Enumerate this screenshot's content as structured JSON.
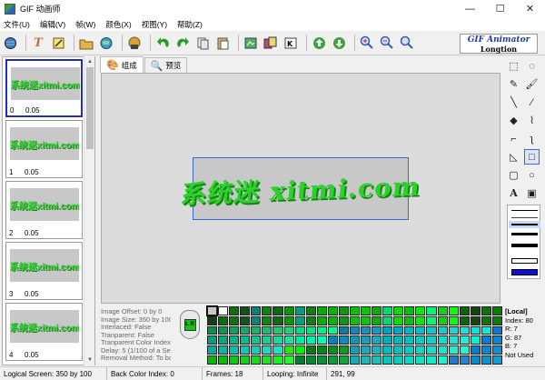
{
  "window": {
    "title": "GIF 动画师",
    "min": "—",
    "max": "☐",
    "close": "✕"
  },
  "menu": [
    "文件(U)",
    "编辑(V)",
    "帧(W)",
    "颜色(X)",
    "视图(Y)",
    "帮助(Z)"
  ],
  "toolbar": {
    "icons": [
      "globe-icon",
      "text-icon",
      "wizard-icon",
      "open-icon",
      "web-icon",
      "save-icon",
      "undo-icon",
      "redo-icon",
      "copy-icon",
      "paste-icon",
      "new-frame-icon",
      "frames-icon",
      "export-icon",
      "up-icon",
      "down-icon",
      "zoom-in-icon",
      "zoom-out-icon",
      "zoom-fit-icon"
    ]
  },
  "brand": {
    "line1": "GIF Animator",
    "line2": "Longtion"
  },
  "frames": [
    {
      "index": "0",
      "delay": "0.05",
      "text": "系统迷xitmi.com"
    },
    {
      "index": "1",
      "delay": "0.05",
      "text": "系统迷xitmi.com"
    },
    {
      "index": "2",
      "delay": "0.05",
      "text": "系统迷xitmi.com"
    },
    {
      "index": "3",
      "delay": "0.05",
      "text": "系统迷xitmi.com"
    },
    {
      "index": "4",
      "delay": "0.05",
      "text": "系统迷xitmi.com"
    }
  ],
  "tabs": [
    {
      "label": "组成",
      "icon": "compose-icon"
    },
    {
      "label": "预览",
      "icon": "preview-icon"
    }
  ],
  "canvas": {
    "text": "系统迷 xitmi.com"
  },
  "frame_info": [
    "Image Offset: 0 by 0",
    "Image Size: 350 by 100",
    "Interlaced: False",
    "Tranparent: False",
    "Tranparent Color Index:",
    "Delay: 5 (1/100 of a Sec",
    "Removal Method: To ba"
  ],
  "lr_label": "L R",
  "color_info": {
    "title": "[Local]",
    "index": "Index: 80",
    "r": "R: 7",
    "g": "G: 87",
    "b": "B: 7",
    "used": "Not Used"
  },
  "status": [
    "Logical Screen: 350 by 100",
    "Back Color Index: 0",
    "Frames: 18",
    "Looping: Infinite",
    "291, 99"
  ],
  "colors": {
    "accent": "#2030b0",
    "text_green": "#2ed02e"
  }
}
